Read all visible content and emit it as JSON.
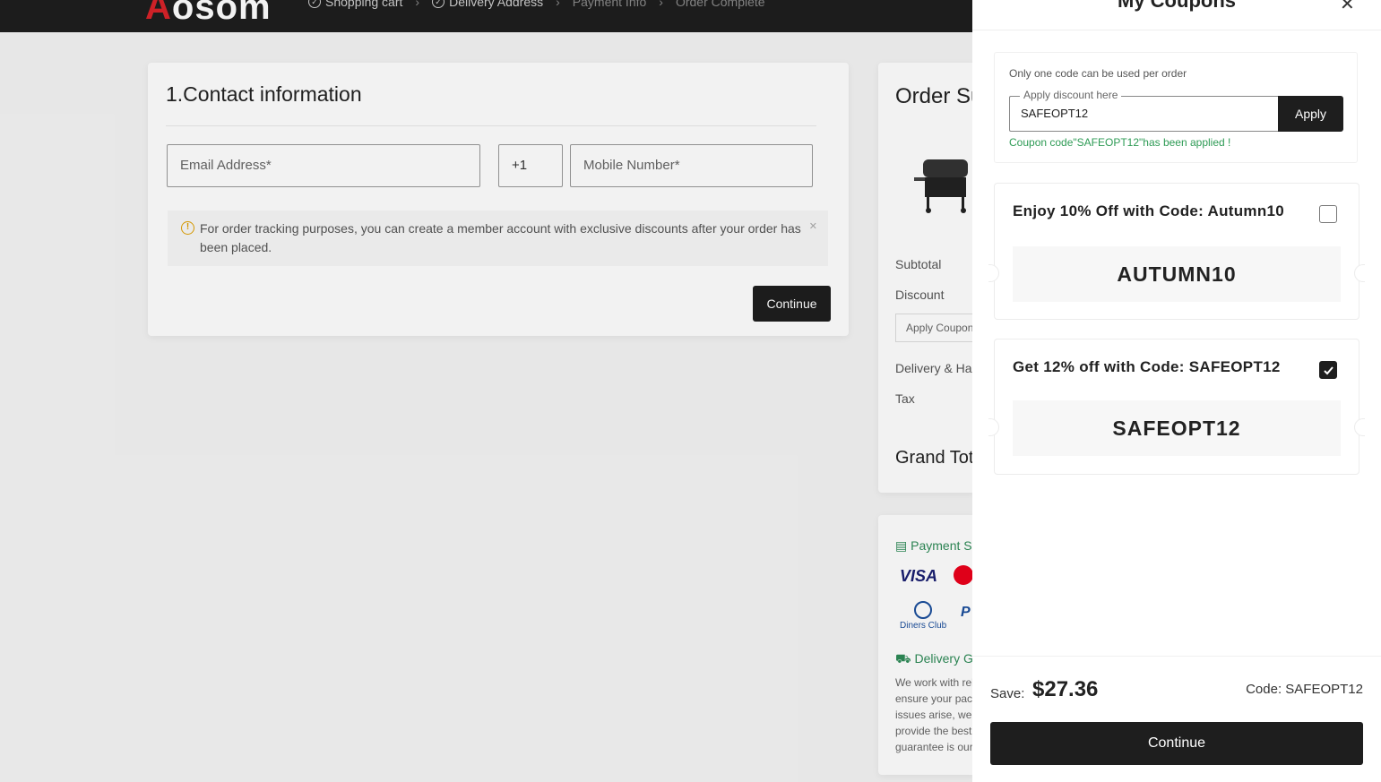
{
  "header": {
    "logo": "Aosom",
    "steps": [
      "Shopping cart",
      "Delivery Address",
      "Payment Info",
      "Order Complete"
    ]
  },
  "contact": {
    "title": "1.Contact information",
    "email_placeholder": "Email Address*",
    "country_code": "+1",
    "mobile_placeholder": "Mobile Number*",
    "notice": "For order tracking purposes, you can create a member account with exclusive discounts after your order has been placed.",
    "continue_label": "Continue"
  },
  "summary": {
    "title": "Order Summary",
    "subtotal_label": "Subtotal",
    "discount_label": "Discount",
    "coupon_label": "Apply Coupon",
    "delivery_label": "Delivery & Handling",
    "tax_label": "Tax",
    "grand_total_label": "Grand Total"
  },
  "payment": {
    "title": "Payment Security",
    "visa": "VISA",
    "diners": "Diners Club",
    "delivery_title": "Delivery Guarantee",
    "delivery_lines": [
      "We work with reliable",
      "ensure your package",
      "issues arise, we",
      "provide the best",
      "guarantee is our"
    ]
  },
  "drawer": {
    "title": "My Coupons",
    "note": "Only one code can be used per order",
    "input_legend": "Apply discount here",
    "input_value": "SAFEOPT12",
    "apply_label": "Apply",
    "applied_message": "Coupon code\"SAFEOPT12\"has been applied !",
    "coupons": [
      {
        "label": "Enjoy 10% Off with Code: Autumn10",
        "code": "AUTUMN10",
        "checked": false
      },
      {
        "label": "Get 12% off with Code: SAFEOPT12",
        "code": "SAFEOPT12",
        "checked": true
      }
    ],
    "save_label": "Save:",
    "save_amount": "$27.36",
    "code_label": "Code: SAFEOPT12",
    "continue_label": "Continue"
  },
  "colors": {
    "dark": "#1e1e1e",
    "success": "#2e9b55",
    "brand_red": "#d8232a"
  }
}
